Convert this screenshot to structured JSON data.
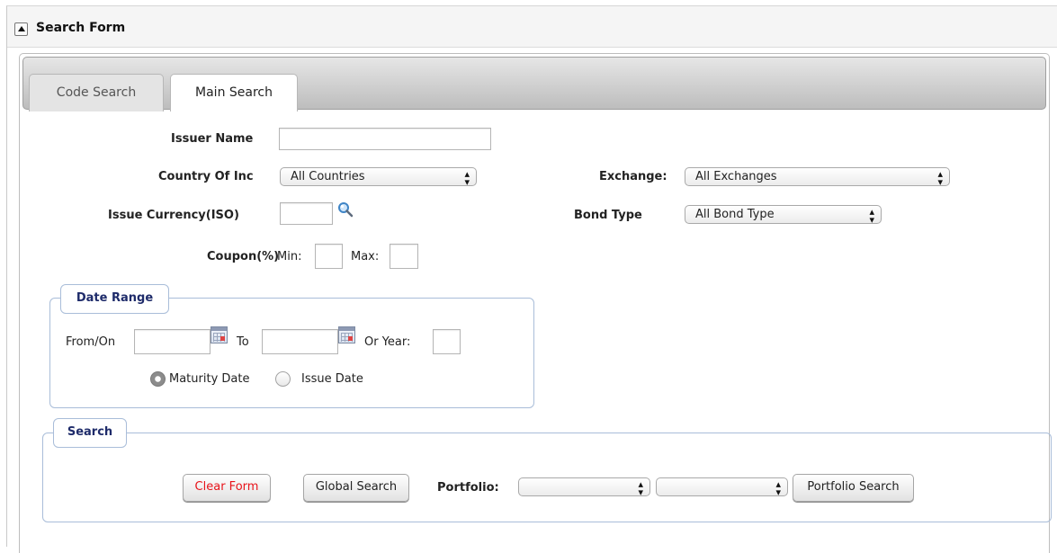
{
  "panel": {
    "title": "Search Form"
  },
  "tabs": [
    {
      "label": "Code Search",
      "active": false
    },
    {
      "label": "Main Search",
      "active": true
    }
  ],
  "form": {
    "issuer_name": {
      "label": "Issuer Name",
      "value": ""
    },
    "country_of_inc": {
      "label": "Country Of Inc",
      "selected": "All Countries"
    },
    "exchange": {
      "label": "Exchange:",
      "selected": "All Exchanges"
    },
    "issue_currency": {
      "label": "Issue Currency(ISO)",
      "value": ""
    },
    "bond_type": {
      "label": "Bond Type",
      "selected": "All Bond Type"
    },
    "coupon": {
      "label": "Coupon(%)",
      "min_label": "Min:",
      "max_label": "Max:",
      "min_value": "",
      "max_value": ""
    }
  },
  "date_range": {
    "legend": "Date Range",
    "from_label": "From/On",
    "to_label": "To",
    "year_label": "Or Year:",
    "from_value": "",
    "to_value": "",
    "year_value": "",
    "radio_maturity": "Maturity Date",
    "radio_issue": "Issue Date",
    "selected": "Maturity Date"
  },
  "search_section": {
    "legend": "Search",
    "clear_button": "Clear Form",
    "global_button": "Global Search",
    "portfolio_label": "Portfolio:",
    "portfolio_select_1": "",
    "portfolio_select_2": "",
    "portfolio_button": "Portfolio Search"
  },
  "colors": {
    "legend_text": "#1e2b6a",
    "fieldset_border": "#a9bdd9",
    "clear_button_text": "#e8141b",
    "select_text": "#222222"
  },
  "icons": {
    "collapse": "triangle-up-icon",
    "lookup": "magnifier-icon",
    "calendar": "calendar-icon"
  }
}
